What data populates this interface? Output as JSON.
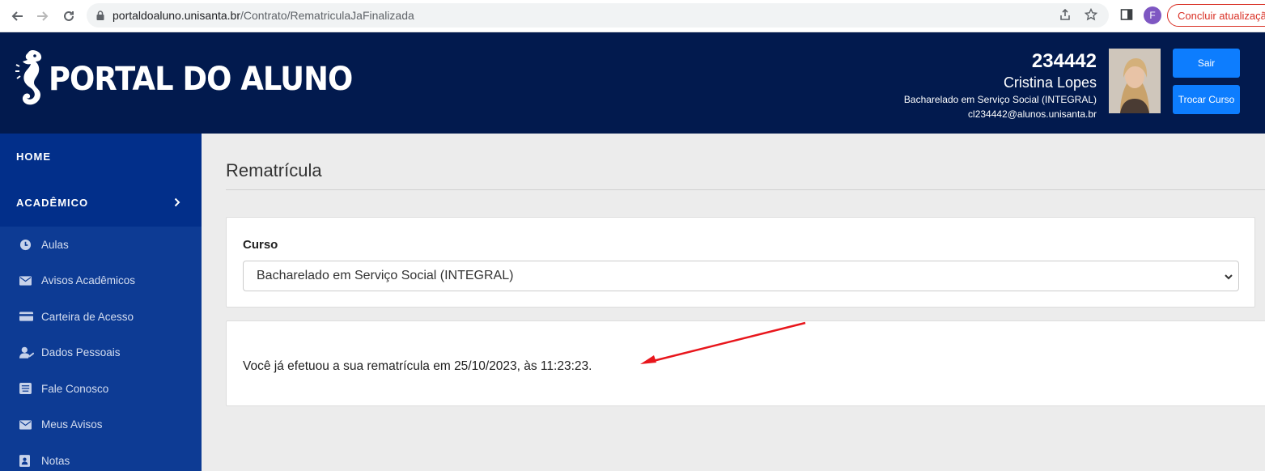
{
  "browser": {
    "url_host": "portaldoaluno.unisanta.br",
    "url_path": "/Contrato/RematriculaJaFinalizada",
    "profile_initial": "F",
    "update_label": "Concluir atualização"
  },
  "header": {
    "logo_text": "PORTAL DO ALUNO",
    "user_id": "234442",
    "user_name": "Cristina Lopes",
    "course": "Bacharelado em Serviço Social (INTEGRAL)",
    "email": "cl234442@alunos.unisanta.br",
    "btn_sair": "Sair",
    "btn_trocar": "Trocar Curso"
  },
  "sidebar": {
    "home": "HOME",
    "academico": "ACADÊMICO",
    "items": [
      {
        "label": "Aulas",
        "icon": "clock-icon"
      },
      {
        "label": "Avisos Acadêmicos",
        "icon": "envelope-icon"
      },
      {
        "label": "Carteira de Acesso",
        "icon": "card-icon"
      },
      {
        "label": "Dados Pessoais",
        "icon": "user-edit-icon"
      },
      {
        "label": "Fale Conosco",
        "icon": "inbox-icon"
      },
      {
        "label": "Meus Avisos",
        "icon": "envelope-icon"
      },
      {
        "label": "Notas",
        "icon": "notebook-icon"
      }
    ]
  },
  "main": {
    "title": "Rematrícula",
    "curso_label": "Curso",
    "curso_selected": "Bacharelado em Serviço Social (INTEGRAL)",
    "message": "Você já efetuou a sua rematrícula em 25/10/2023, às 11:23:23."
  },
  "colors": {
    "header_bg": "#021a4e",
    "sidebar_bg": "#0d3b94",
    "button_blue": "#0d7dfe",
    "arrow_red": "#e8161c"
  }
}
